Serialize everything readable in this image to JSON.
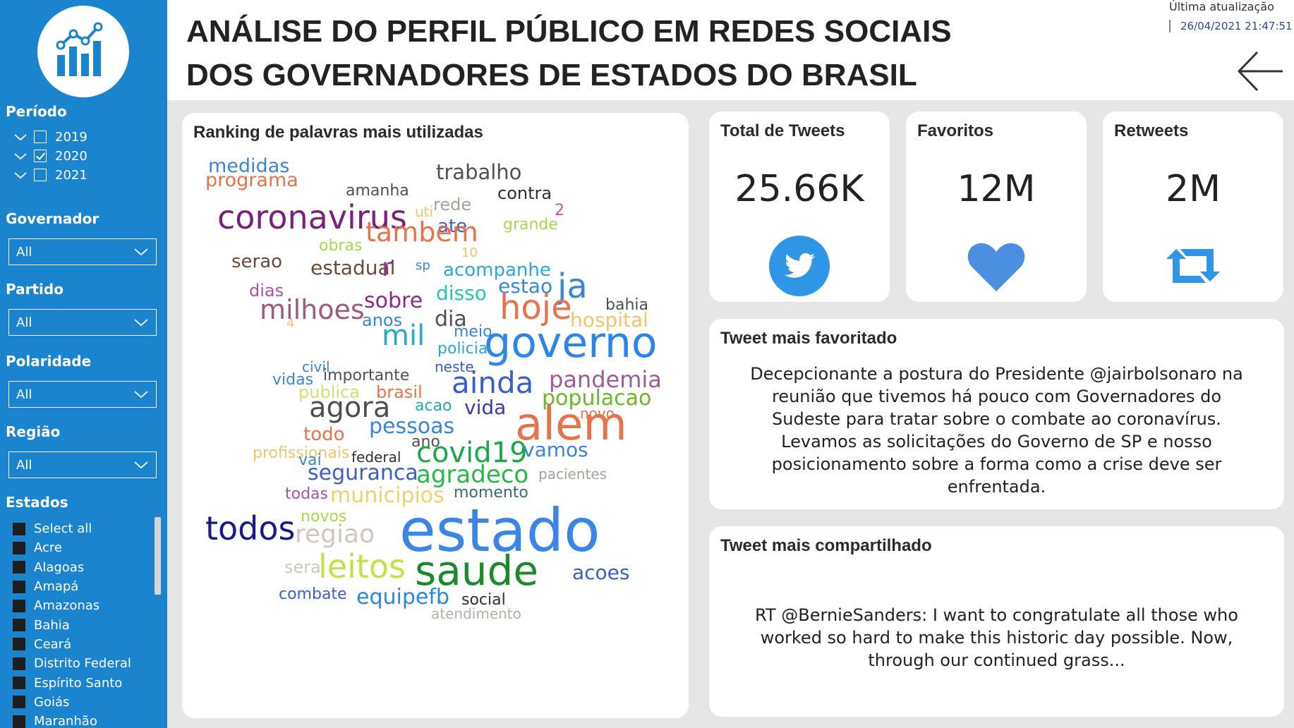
{
  "sidebar": {
    "logo_icon": "bar-chart-trend-icon",
    "periodo": {
      "title": "Período",
      "years": [
        {
          "label": "2019",
          "checked": false
        },
        {
          "label": "2020",
          "checked": true
        },
        {
          "label": "2021",
          "checked": false
        }
      ]
    },
    "governador": {
      "title": "Governador",
      "value": "All"
    },
    "partido": {
      "title": "Partido",
      "value": "All"
    },
    "polaridade": {
      "title": "Polaridade",
      "value": "All"
    },
    "regiao": {
      "title": "Região",
      "value": "All"
    },
    "estados": {
      "title": "Estados",
      "items": [
        "Select all",
        "Acre",
        "Alagoas",
        "Amapá",
        "Amazonas",
        "Bahia",
        "Ceará",
        "Distrito Federal",
        "Espírito Santo",
        "Goiás",
        "Maranhão"
      ]
    }
  },
  "header": {
    "title": "ANÁLISE DO PERFIL PÚBLICO EM REDES SOCIAIS DOS GOVERNADORES DE ESTADOS DO BRASIL",
    "update_label": "Última atualização",
    "update_value": "26/04/2021 21:47:51"
  },
  "wordcloud": {
    "title": "Ranking de palavras mais utilizadas",
    "words": [
      {
        "text": "medidas",
        "color": "#3a86d6"
      },
      {
        "text": "programa",
        "color": "#e8734a"
      },
      {
        "text": "trabalho",
        "color": "#505050"
      },
      {
        "text": "amanha",
        "color": "#505050"
      },
      {
        "text": "contra",
        "color": "#303030"
      },
      {
        "text": "coronavirus",
        "color": "#7b1f7a"
      },
      {
        "text": "uti",
        "color": "#f2c46b"
      },
      {
        "text": "rede",
        "color": "#a8a29a"
      },
      {
        "text": "2",
        "color": "#d64fb0"
      },
      {
        "text": "ate",
        "color": "#3a5fc8"
      },
      {
        "text": "grande",
        "color": "#a8d848"
      },
      {
        "text": "tambem",
        "color": "#e8734a"
      },
      {
        "text": "10",
        "color": "#f2c46b"
      },
      {
        "text": "obras",
        "color": "#a8d848"
      },
      {
        "text": "serao",
        "color": "#6a4a3a"
      },
      {
        "text": "sp",
        "color": "#3a86d6"
      },
      {
        "text": "acompanhe",
        "color": "#2aa8d8"
      },
      {
        "text": "estadual",
        "color": "#6a4a3a"
      },
      {
        "text": "r",
        "color": "#8a3a8a"
      },
      {
        "text": "dias",
        "color": "#a855a8"
      },
      {
        "text": "estao",
        "color": "#3a86d6"
      },
      {
        "text": "ja",
        "color": "#3a86d6"
      },
      {
        "text": "disso",
        "color": "#28c6a8"
      },
      {
        "text": "bahia",
        "color": "#505050"
      },
      {
        "text": "milhoes",
        "color": "#a05a7a"
      },
      {
        "text": "sobre",
        "color": "#8a2a8a"
      },
      {
        "text": "hoje",
        "color": "#e8734a"
      },
      {
        "text": "dia",
        "color": "#505050"
      },
      {
        "text": "anos",
        "color": "#3a86d6"
      },
      {
        "text": "hospital",
        "color": "#f2c46b"
      },
      {
        "text": "4",
        "color": "#f2c46b"
      },
      {
        "text": "meio",
        "color": "#3a86d6"
      },
      {
        "text": "mil",
        "color": "#28a8c8"
      },
      {
        "text": "governo",
        "color": "#2a86e8"
      },
      {
        "text": "policia",
        "color": "#2aa8d8"
      },
      {
        "text": "civil",
        "color": "#3a86d6"
      },
      {
        "text": "neste",
        "color": "#3a5fc8"
      },
      {
        "text": "vidas",
        "color": "#3a86d6"
      },
      {
        "text": "importante",
        "color": "#505050"
      },
      {
        "text": "ainda",
        "color": "#3a5fc8"
      },
      {
        "text": "pandemia",
        "color": "#a05a9a"
      },
      {
        "text": "publica",
        "color": "#d0e070"
      },
      {
        "text": "brasil",
        "color": "#e8734a"
      },
      {
        "text": "populacao",
        "color": "#6ab82a"
      },
      {
        "text": "agora",
        "color": "#505050"
      },
      {
        "text": "acao",
        "color": "#28a8a8"
      },
      {
        "text": "vida",
        "color": "#3a3aa8"
      },
      {
        "text": "novo",
        "color": "#e8734a"
      },
      {
        "text": "alem",
        "color": "#e8734a"
      },
      {
        "text": "pessoas",
        "color": "#3a86d6"
      },
      {
        "text": "todo",
        "color": "#e8734a"
      },
      {
        "text": "ano",
        "color": "#505050"
      },
      {
        "text": "profissionais",
        "color": "#f2c46b"
      },
      {
        "text": "covid19",
        "color": "#1aa848"
      },
      {
        "text": "vamos",
        "color": "#3a86d6"
      },
      {
        "text": "federal",
        "color": "#303030"
      },
      {
        "text": "vai",
        "color": "#3a86d6"
      },
      {
        "text": "pacientes",
        "color": "#a8a29a"
      },
      {
        "text": "seguranca",
        "color": "#3a5fc8"
      },
      {
        "text": "agradeco",
        "color": "#28b848"
      },
      {
        "text": "momento",
        "color": "#3a6a6a"
      },
      {
        "text": "todas",
        "color": "#a855a8"
      },
      {
        "text": "municipios",
        "color": "#f2d070"
      },
      {
        "text": "novos",
        "color": "#a8d848"
      },
      {
        "text": "todos",
        "color": "#1a1a8a"
      },
      {
        "text": "regiao",
        "color": "#d0c8c0"
      },
      {
        "text": "estado",
        "color": "#3a86e8"
      },
      {
        "text": "sera",
        "color": "#d0c8c0"
      },
      {
        "text": "leitos",
        "color": "#c8e048"
      },
      {
        "text": "saude",
        "color": "#1a8a2a"
      },
      {
        "text": "acoes",
        "color": "#3a5fc8"
      },
      {
        "text": "combate",
        "color": "#3a5fc8"
      },
      {
        "text": "equipefb",
        "color": "#2a86e8"
      },
      {
        "text": "social",
        "color": "#303030"
      },
      {
        "text": "atendimento",
        "color": "#b8b0a8"
      }
    ]
  },
  "kpis": [
    {
      "title": "Total de Tweets",
      "value": "25.66K",
      "icon": "twitter-bird-icon"
    },
    {
      "title": "Favoritos",
      "value": "12M",
      "icon": "heart-icon"
    },
    {
      "title": "Retweets",
      "value": "2M",
      "icon": "retweet-icon"
    }
  ],
  "accent_color": "#2e96e6",
  "sidebar_color": "#1b84cf",
  "tweet_fav": {
    "title": "Tweet mais favoritado",
    "text": "Decepcionante a postura do Presidente @jairbolsonaro na reunião que tivemos há pouco com Governadores do Sudeste para tratar sobre o combate ao coronavírus. Levamos as solicitações do Governo de SP e nosso posicionamento sobre a forma como a crise deve ser enfrentada."
  },
  "tweet_shared": {
    "title": "Tweet mais compartilhado",
    "text": "RT @BernieSanders: I want to congratulate all those who worked so hard to make this historic day possible. Now, through our continued grass..."
  }
}
